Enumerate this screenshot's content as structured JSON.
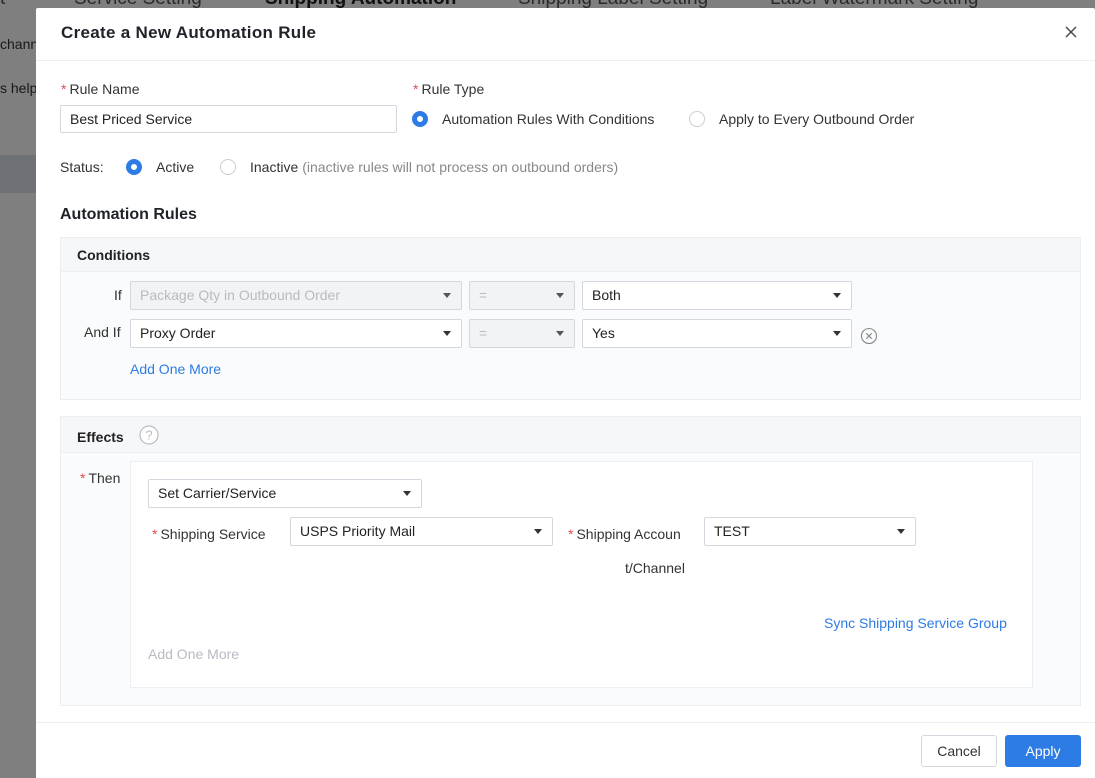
{
  "background": {
    "tabs": [
      "Service Setting",
      "Shipping Automation",
      "Shipping Label Setting",
      "Label Watermark Setting"
    ],
    "first_tab_fragment": "t",
    "side_texts": [
      "channe",
      "s help"
    ]
  },
  "modal": {
    "title": "Create a New Automation Rule",
    "rule_name": {
      "label": "Rule Name",
      "value": "Best Priced Service"
    },
    "rule_type": {
      "label": "Rule Type",
      "options": [
        "Automation Rules With Conditions",
        "Apply to Every Outbound Order"
      ],
      "selected": "Automation Rules With Conditions"
    },
    "status": {
      "label": "Status:",
      "active_label": "Active",
      "inactive_label": "Inactive",
      "inactive_hint": "(inactive rules will not process on outbound orders)",
      "selected": "Active"
    },
    "automation_rules_title": "Automation Rules",
    "conditions": {
      "title": "Conditions",
      "rows": [
        {
          "prefix": "If",
          "field": "Package Qty in Outbound Order",
          "operator": "=",
          "value": "Both",
          "field_disabled": true,
          "removable": false
        },
        {
          "prefix": "And If",
          "field": "Proxy Order",
          "operator": "=",
          "value": "Yes",
          "field_disabled": false,
          "removable": true
        }
      ],
      "add_more": "Add One More"
    },
    "effects": {
      "title": "Effects",
      "then_label": "Then",
      "action": "Set Carrier/Service",
      "shipping_service_label": "Shipping Service",
      "shipping_service_value": "USPS Priority Mail",
      "shipping_account_label_line1": "Shipping Accoun",
      "shipping_account_label_line2": "t/Channel",
      "shipping_account_value": "TEST",
      "sync_link": "Sync Shipping Service Group",
      "add_more": "Add One More"
    },
    "footer": {
      "cancel": "Cancel",
      "apply": "Apply"
    }
  },
  "colors": {
    "primary": "#2d7be5",
    "required": "#e34d4d",
    "overlay": "rgba(0,0,0,0.5)"
  }
}
